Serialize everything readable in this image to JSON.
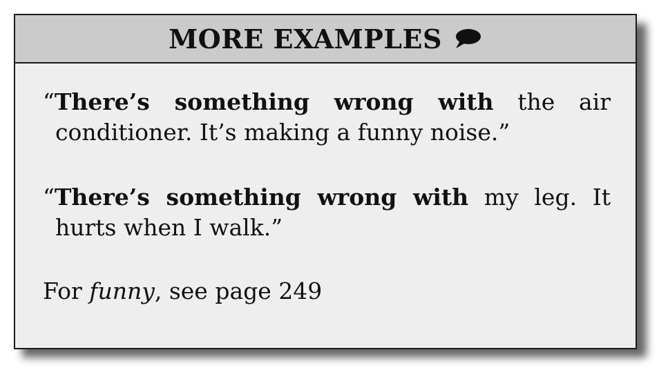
{
  "header": {
    "title": "MORE EXAMPLES",
    "icon": "speech-bubble-icon"
  },
  "examples": [
    {
      "open_quote": "“",
      "bold_phrase": "There’s something wrong with",
      "rest": " the air conditioner. It’s making a funny noise.”"
    },
    {
      "open_quote": "“",
      "bold_phrase": "There’s something wrong with",
      "rest": " my leg. It hurts when I walk.”"
    }
  ],
  "crossref": {
    "prefix": "For ",
    "word": "funny",
    "suffix": ", see page 249"
  }
}
